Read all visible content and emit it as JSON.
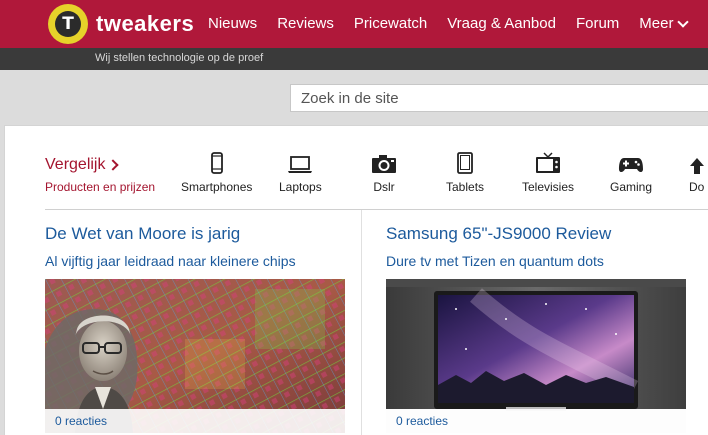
{
  "header": {
    "logo_text": "tweakers",
    "logo_letter": "T",
    "brand_color": "#b0183a",
    "nav": [
      "Nieuws",
      "Reviews",
      "Pricewatch",
      "Vraag & Aanbod",
      "Forum"
    ],
    "more_label": "Meer"
  },
  "tagline": "Wij stellen technologie op de proef",
  "search": {
    "placeholder": "Zoek in de site",
    "value": ""
  },
  "compare": {
    "title": "Vergelijk",
    "subtitle": "Producten en prijzen",
    "categories": [
      {
        "label": "Smartphones",
        "icon": "smartphone-icon"
      },
      {
        "label": "Laptops",
        "icon": "laptop-icon"
      },
      {
        "label": "Dslr",
        "icon": "camera-icon"
      },
      {
        "label": "Tablets",
        "icon": "tablet-icon"
      },
      {
        "label": "Televisies",
        "icon": "television-icon"
      },
      {
        "label": "Gaming",
        "icon": "gamepad-icon"
      },
      {
        "label": "Do",
        "icon": "more-icon"
      }
    ]
  },
  "articles": [
    {
      "title": "De Wet van Moore is jarig",
      "subtitle": "Al vijftig jaar leidraad naar kleinere chips",
      "reactions": "0 reacties"
    },
    {
      "title": "Samsung 65\"-JS9000 Review",
      "subtitle": "Dure tv met Tizen en quantum dots",
      "reactions": "0 reacties"
    }
  ]
}
